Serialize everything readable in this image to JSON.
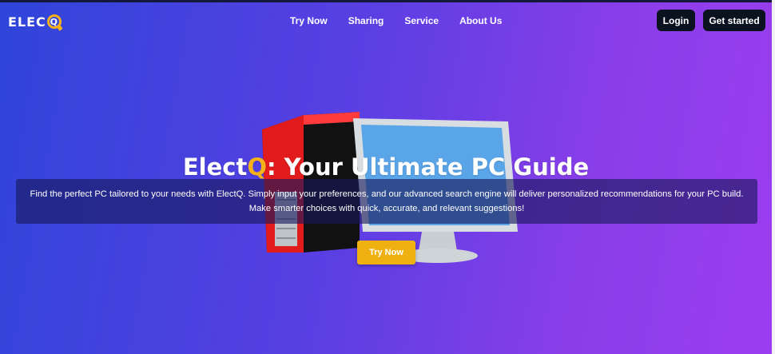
{
  "brand": {
    "name_part": "ELEC",
    "q_letter": "Q"
  },
  "nav": {
    "items": [
      {
        "label": "Try Now"
      },
      {
        "label": "Sharing"
      },
      {
        "label": "Service"
      },
      {
        "label": "About Us"
      }
    ],
    "login_label": "Login",
    "get_started_label": "Get started"
  },
  "hero": {
    "title_start": "Elect",
    "title_q": "Q",
    "title_end": ": Your Ultimate PC Guide",
    "description": "Find the perfect PC tailored to your needs with ElectQ. Simply input your preferences, and our advanced search engine will deliver personalized recommendations for your PC build. Make smarter choices with quick, accurate, and relevant suggestions!",
    "cta_label": "Try Now"
  },
  "colors": {
    "accent": "#efb012",
    "button_dark": "#0b1220",
    "gradient_start": "#2f45d9",
    "gradient_end": "#9b3df0"
  }
}
